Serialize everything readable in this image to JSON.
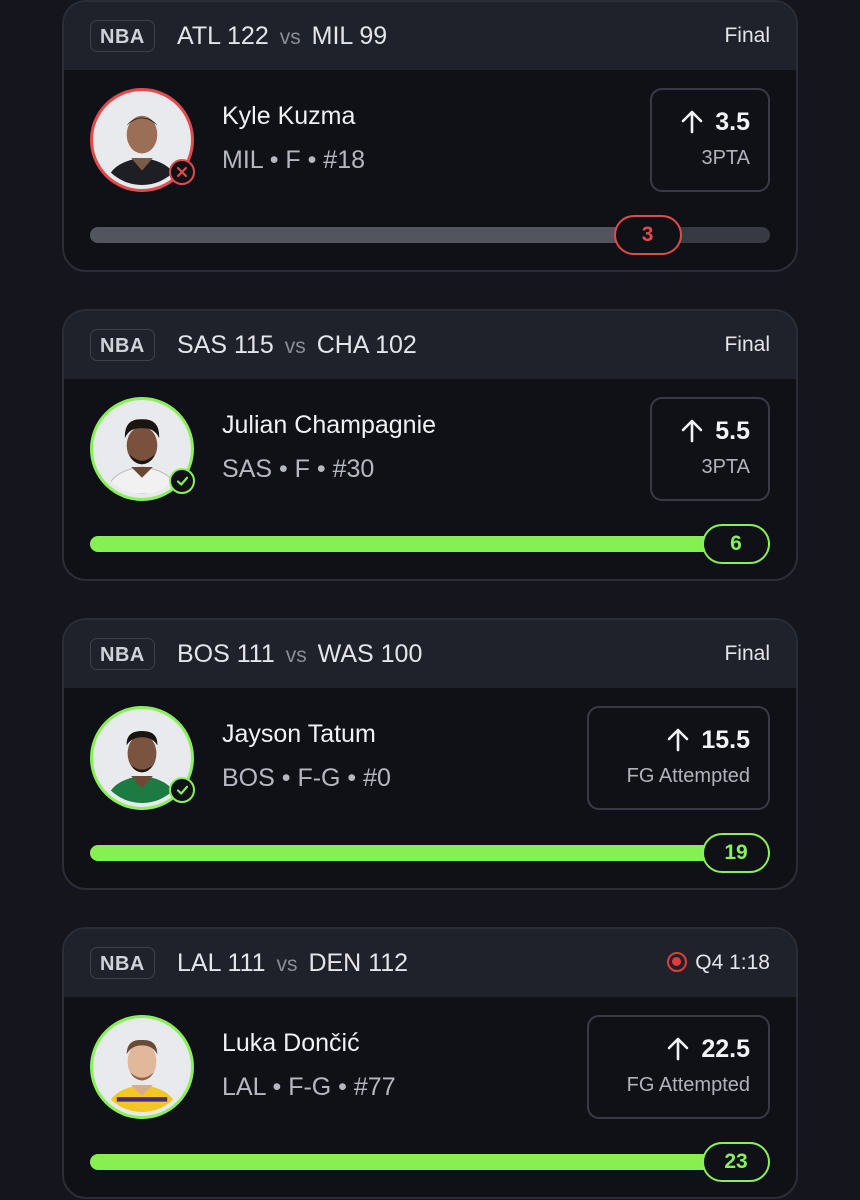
{
  "colors": {
    "win": "#86ef51",
    "loss": "#e24b4b",
    "live": "#e23b3b"
  },
  "cards": [
    {
      "league": "NBA",
      "team1": "ATL",
      "score1": "122",
      "vs": "vs",
      "team2": "MIL",
      "score2": "99",
      "status": "Final",
      "live": false,
      "player": {
        "name": "Kyle Kuzma",
        "meta": "MIL • F • #18"
      },
      "line": {
        "value": "3.5",
        "stat": "3PTA",
        "direction": "up-arrow-icon"
      },
      "actual": "3",
      "progress_fraction": 0.82,
      "result": "loss"
    },
    {
      "league": "NBA",
      "team1": "SAS",
      "score1": "115",
      "vs": "vs",
      "team2": "CHA",
      "score2": "102",
      "status": "Final",
      "live": false,
      "player": {
        "name": "Julian Champagnie",
        "meta": "SAS • F • #30"
      },
      "line": {
        "value": "5.5",
        "stat": "3PTA",
        "direction": "up-arrow-icon"
      },
      "actual": "6",
      "progress_fraction": 1.0,
      "result": "win"
    },
    {
      "league": "NBA",
      "team1": "BOS",
      "score1": "111",
      "vs": "vs",
      "team2": "WAS",
      "score2": "100",
      "status": "Final",
      "live": false,
      "player": {
        "name": "Jayson Tatum",
        "meta": "BOS • F-G • #0"
      },
      "line": {
        "value": "15.5",
        "stat": "FG Attempted",
        "direction": "up-arrow-icon"
      },
      "actual": "19",
      "progress_fraction": 1.0,
      "result": "win"
    },
    {
      "league": "NBA",
      "team1": "LAL",
      "score1": "111",
      "vs": "vs",
      "team2": "DEN",
      "score2": "112",
      "status": "Q4 1:18",
      "live": true,
      "player": {
        "name": "Luka Dončić",
        "meta": "LAL • F-G • #77"
      },
      "line": {
        "value": "22.5",
        "stat": "FG Attempted",
        "direction": "up-arrow-icon"
      },
      "actual": "23",
      "progress_fraction": 1.0,
      "result": "win"
    }
  ]
}
